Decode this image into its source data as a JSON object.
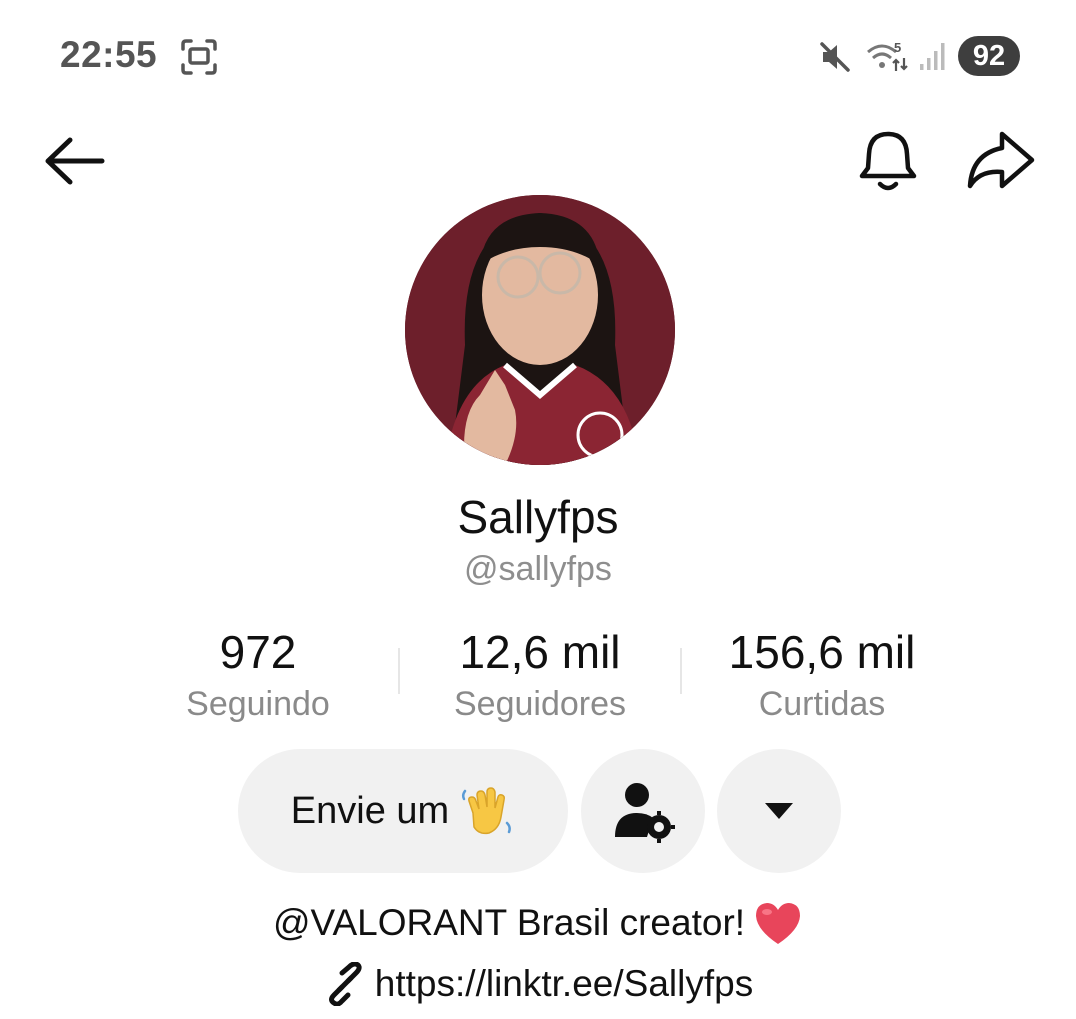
{
  "status_bar": {
    "time": "22:55",
    "battery": "92",
    "wifi_badge": "5",
    "icons": [
      "screenshot-icon",
      "mute-icon",
      "wifi-icon",
      "signal-icon",
      "battery-icon"
    ]
  },
  "nav": {
    "icons": [
      "back-arrow-icon",
      "bell-icon",
      "share-icon"
    ]
  },
  "profile": {
    "display_name": "Sallyfps",
    "handle": "@sallyfps"
  },
  "stats": [
    {
      "value": "972",
      "label": "Seguindo"
    },
    {
      "value": "12,6 mil",
      "label": "Seguidores"
    },
    {
      "value": "156,6 mil",
      "label": "Curtidas"
    }
  ],
  "actions": {
    "wave_label": "Envie um",
    "icons": [
      "waving-hand-icon",
      "user-settings-icon",
      "dropdown-triangle-icon"
    ]
  },
  "bio": {
    "text": "@VALORANT Brasil creator!",
    "link": "https://linktr.ee/Sallyfps",
    "icons": [
      "heart-icon",
      "link-icon"
    ]
  },
  "colors": {
    "muted_text": "#8a8a8a",
    "button_bg": "#f1f1f1",
    "avatar_bg": "#6d1f2b",
    "heart": "#e8455b"
  }
}
